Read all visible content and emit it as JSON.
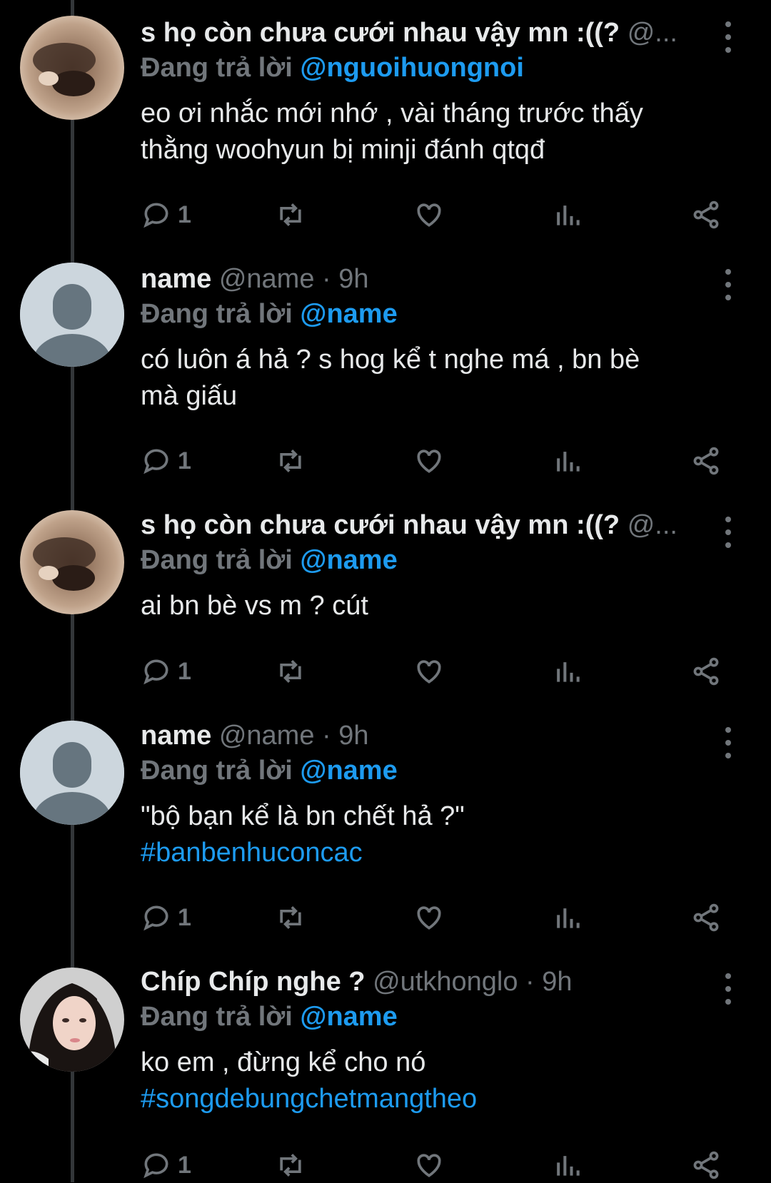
{
  "reply_prefix": "Đang trả lời",
  "colors": {
    "background": "#000000",
    "accent": "#1d9bf0",
    "muted": "#71767b",
    "text": "#e7e9ea"
  },
  "tweets": [
    {
      "display_name": "s họ còn chưa cưới nhau vậy mn :((?",
      "handle_meta": "@...",
      "reply_to": "@nguoihuongnoi",
      "text_lines": [
        "eo ơi nhắc mới nhớ , vài tháng trước thấy",
        "thằng woohyun bị minji đánh qtqđ"
      ],
      "hashtag": "",
      "reply_count": "1",
      "avatar": "blurry-face-photo"
    },
    {
      "display_name": "name",
      "handle_meta": "@name · 9h",
      "reply_to": "@name",
      "text_lines": [
        "có luôn á hả ? s hog kể t nghe má , bn bè",
        "mà giấu"
      ],
      "hashtag": "",
      "reply_count": "1",
      "avatar": "default-avatar"
    },
    {
      "display_name": "s họ còn chưa cưới nhau vậy mn :((?",
      "handle_meta": "@...",
      "reply_to": "@name",
      "text_lines": [
        "ai bn bè vs m ? cút"
      ],
      "hashtag": "",
      "reply_count": "1",
      "avatar": "blurry-face-photo"
    },
    {
      "display_name": "name",
      "handle_meta": "@name · 9h",
      "reply_to": "@name",
      "text_lines": [
        "\"bộ bạn kể là bn chết hả ?\""
      ],
      "hashtag": "#banbenhuconcac",
      "reply_count": "1",
      "avatar": "default-avatar"
    },
    {
      "display_name": "Chíp Chíp nghe ?",
      "handle_meta": "@utkhonglo · 9h",
      "reply_to": "@name",
      "text_lines": [
        "ko em , đừng kể cho nó"
      ],
      "hashtag": "#songdebungchetmangtheo",
      "reply_count": "1",
      "avatar": "girl-portrait-photo"
    }
  ]
}
